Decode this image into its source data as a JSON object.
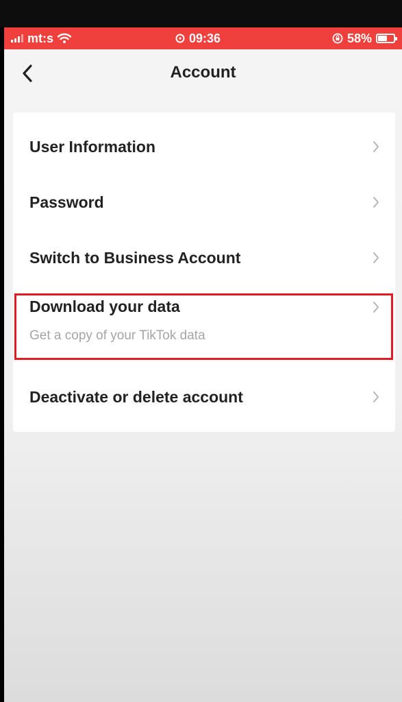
{
  "status_bar": {
    "carrier": "mt:s",
    "time": "09:36",
    "battery": "58%",
    "battery_level": 0.58
  },
  "nav": {
    "title": "Account",
    "back_icon": "chevron-left-icon"
  },
  "menu": {
    "items": [
      {
        "label": "User Information",
        "subtitle": ""
      },
      {
        "label": "Password",
        "subtitle": ""
      },
      {
        "label": "Switch to Business Account",
        "subtitle": ""
      },
      {
        "label": "Download your data",
        "subtitle": "Get a copy of your TikTok data",
        "highlighted": true
      },
      {
        "label": "Deactivate or delete account",
        "subtitle": ""
      }
    ]
  },
  "colors": {
    "status_bar": "#f0403d",
    "highlight_border": "#e01b24",
    "background": "#f4f4f4"
  }
}
